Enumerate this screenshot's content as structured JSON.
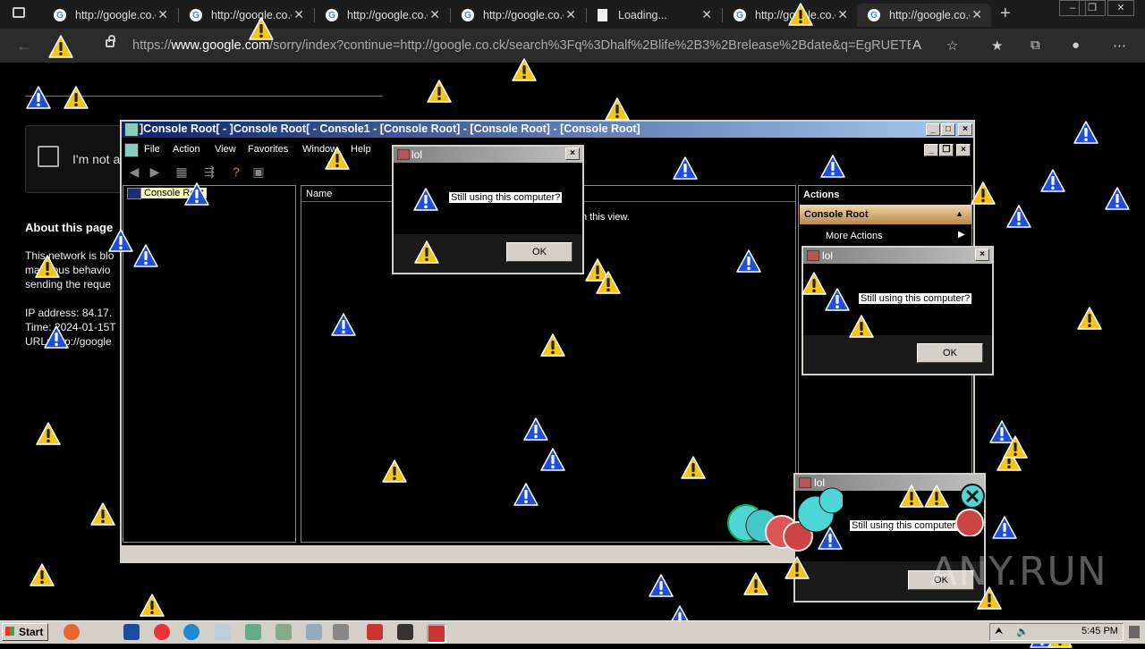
{
  "browser": {
    "tabs": [
      {
        "title": "http://google.co.ck",
        "icon": "google-icon"
      },
      {
        "title": "http://google.co.ck",
        "icon": "google-icon"
      },
      {
        "title": "http://google.co.ck",
        "icon": "google-icon"
      },
      {
        "title": "http://google.co.ck",
        "icon": "google-icon"
      },
      {
        "title": "Loading...",
        "icon": "page-icon"
      },
      {
        "title": "http://google.co.ck",
        "icon": "google-icon"
      },
      {
        "title": "http://google.co.ck",
        "icon": "google-icon"
      }
    ],
    "new_tab": "+",
    "close_glyph": "✕",
    "url_prefix": "https://",
    "url_host": "www.google.com",
    "url_rest": "/sorry/index?continue=http://google.co.ck/search%3Fq%3Dhalf%2Blife%2B3%2Brelease%2Bdate&q=EgRUETBrGJ7..."
  },
  "google_page": {
    "captcha_label": "I'm not a",
    "about_title": "About this page",
    "about_lines": [
      "This network is blo",
      "malicious behavio",
      "sending the reque",
      "IP address: 84.17.",
      "Time: 2024-01-15T",
      "URL: http://google"
    ]
  },
  "mmc": {
    "title": "]Console Root[ - ]Console Root[ - Console1 - [Console Root] - [Console Root] - [Console Root]",
    "menu": [
      "File",
      "Action",
      "View",
      "Favorites",
      "Window",
      "Help"
    ],
    "tree_item": "Console Root",
    "list_column": "Name",
    "empty_text": "n this view.",
    "actions_title": "Actions",
    "actions_section": "Console Root",
    "more_actions": "More Actions"
  },
  "dialogs": [
    {
      "title": "lol",
      "message": "Still using this computer?",
      "ok": "OK"
    },
    {
      "title": "lol",
      "message": "Still using this computer?",
      "ok": "OK"
    },
    {
      "title": "lol",
      "message": "Still using this computer?",
      "ok": "OK"
    }
  ],
  "taskbar": {
    "start": "Start",
    "clock": "5:45 PM"
  },
  "watermark": "ANY.RUN",
  "colors": {
    "warning_yellow": "#f5c518",
    "warning_blue": "#1f4fd8",
    "mmc_title_start": "#0a246a",
    "dialog_title": "#808080"
  }
}
